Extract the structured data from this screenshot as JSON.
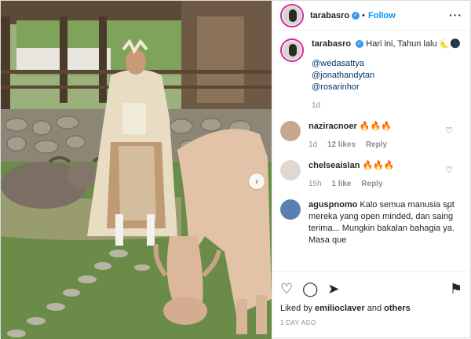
{
  "post": {
    "username": "tarabasro",
    "follow_label": "Follow",
    "dot_separator": "•"
  },
  "caption": {
    "username": "tarabasro",
    "text": "Hari ini, Tahun lalu 🌜🌑",
    "mentions": [
      "@wedasattya",
      "@jonathandytan",
      "@rosarinhor"
    ],
    "time": "1d"
  },
  "comments": [
    {
      "username": "naziracnoer",
      "text": "🔥🔥🔥",
      "time": "1d",
      "likes": "12 likes",
      "reply": "Reply"
    },
    {
      "username": "chelseaislan",
      "text": "🔥🔥🔥",
      "time": "15h",
      "likes": "1 like",
      "reply": "Reply"
    },
    {
      "username": "aguspnomo",
      "text": "Kalo semua manusia spt mereka yang open minded, dan saing terima... Mungkin bakalan bahagia ya. Masa que"
    }
  ],
  "footer": {
    "liked_prefix": "Liked by",
    "liked_user": "emilioclaver",
    "liked_and": "and",
    "liked_others": "others",
    "ago": "1 DAY AGO"
  },
  "icons": {
    "heart": "heart-icon",
    "comment": "comment-icon",
    "share": "share-icon",
    "save": "bookmark-icon",
    "next": "chevron-right-icon"
  },
  "colors": {
    "follow": "#0095f6",
    "verified": "#3897f0"
  }
}
